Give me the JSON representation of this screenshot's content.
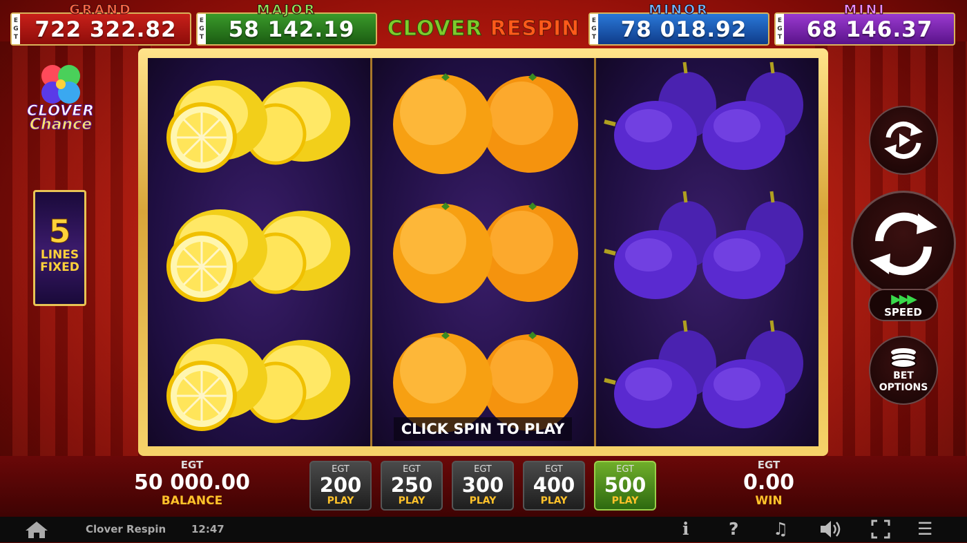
{
  "jackpots": {
    "grand": {
      "title": "GRAND",
      "currency": "EGT",
      "value": "722 322.82"
    },
    "major": {
      "title": "MAJOR",
      "currency": "EGT",
      "value": "58 142.19"
    },
    "minor": {
      "title": "MINOR",
      "currency": "EGT",
      "value": "78 018.92"
    },
    "mini": {
      "title": "MINI",
      "currency": "EGT",
      "value": "68 146.37"
    }
  },
  "game_logo": {
    "part1": "CLOVER",
    "part2": " RESPIN"
  },
  "side_logo": {
    "line1": "CLOVER",
    "line2": "Chance"
  },
  "lines": {
    "count": "5",
    "label1": "LINES",
    "label2": "FIXED"
  },
  "reels": [
    [
      "lemon",
      "lemon",
      "lemon"
    ],
    [
      "orange",
      "orange",
      "orange"
    ],
    [
      "plum",
      "plum",
      "plum"
    ]
  ],
  "hint": "CLICK SPIN TO PLAY",
  "controls": {
    "autoplay_icon": "autoplay-icon",
    "spin_icon": "spin-icon",
    "speed_label": "SPEED",
    "speed_arrows": "▶▶▶",
    "bet_options_label1": "BET",
    "bet_options_label2": "OPTIONS"
  },
  "balance": {
    "currency": "EGT",
    "amount": "50 000.00",
    "label": "BALANCE"
  },
  "win": {
    "currency": "EGT",
    "amount": "0.00",
    "label": "WIN"
  },
  "bets": [
    {
      "currency": "EGT",
      "amount": "200",
      "label": "PLAY",
      "selected": false
    },
    {
      "currency": "EGT",
      "amount": "250",
      "label": "PLAY",
      "selected": false
    },
    {
      "currency": "EGT",
      "amount": "300",
      "label": "PLAY",
      "selected": false
    },
    {
      "currency": "EGT",
      "amount": "400",
      "label": "PLAY",
      "selected": false
    },
    {
      "currency": "EGT",
      "amount": "500",
      "label": "PLAY",
      "selected": true
    }
  ],
  "system_bar": {
    "game_name": "Clover Respin",
    "time": "12:47",
    "icons": [
      "home-icon",
      "info-icon",
      "help-icon",
      "music-icon",
      "volume-icon",
      "fullscreen-icon",
      "menu-icon"
    ],
    "info_glyph": "i",
    "help_glyph": "?",
    "music_glyph": "♫",
    "menu_glyph": "☰"
  },
  "colors": {
    "grand": "#c8201a",
    "major": "#3a9a2a",
    "minor": "#2a78d8",
    "mini": "#9a3ad0",
    "gold": "#e8c454",
    "selected_bet": "#6fae2a"
  }
}
